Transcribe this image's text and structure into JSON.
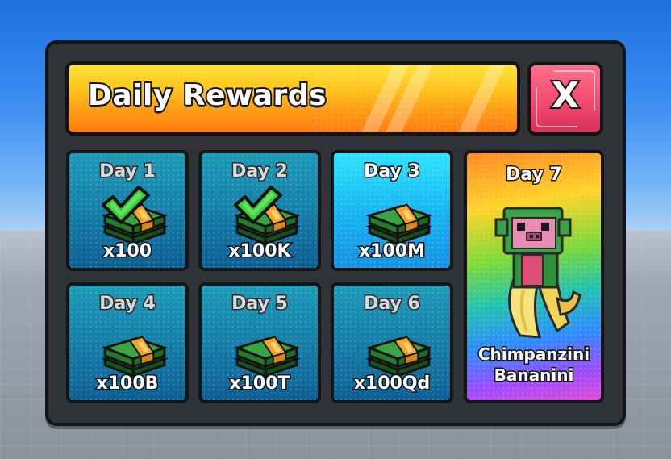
{
  "header": {
    "title": "Daily Rewards",
    "close_label": "X"
  },
  "rewards": [
    {
      "day": "Day 1",
      "amount": "x100",
      "claimed": true,
      "state": "claimed",
      "icon": "cash-stack-icon"
    },
    {
      "day": "Day 2",
      "amount": "x100K",
      "claimed": true,
      "state": "claimed",
      "icon": "cash-stack-icon"
    },
    {
      "day": "Day 3",
      "amount": "x100M",
      "claimed": false,
      "state": "current",
      "icon": "cash-stack-icon"
    },
    {
      "day": "Day 4",
      "amount": "x100B",
      "claimed": false,
      "state": "locked",
      "icon": "cash-stack-icon"
    },
    {
      "day": "Day 5",
      "amount": "x100T",
      "claimed": false,
      "state": "locked",
      "icon": "cash-stack-icon"
    },
    {
      "day": "Day 6",
      "amount": "x100Qd",
      "claimed": false,
      "state": "locked",
      "icon": "cash-stack-icon"
    }
  ],
  "grand_reward": {
    "day": "Day 7",
    "name_line1": "Chimpanzini",
    "name_line2": "Bananini",
    "icon": "chimpanzini-bananini-icon"
  },
  "colors": {
    "title_orange": "#ff9a14",
    "close_pink": "#f24a6e",
    "tile_teal": "#147ca6",
    "tile_active_cyan": "#19b6f2",
    "check_green": "#3ccf3c",
    "cash_green": "#2f8f3a",
    "band_orange": "#f0a02a"
  }
}
